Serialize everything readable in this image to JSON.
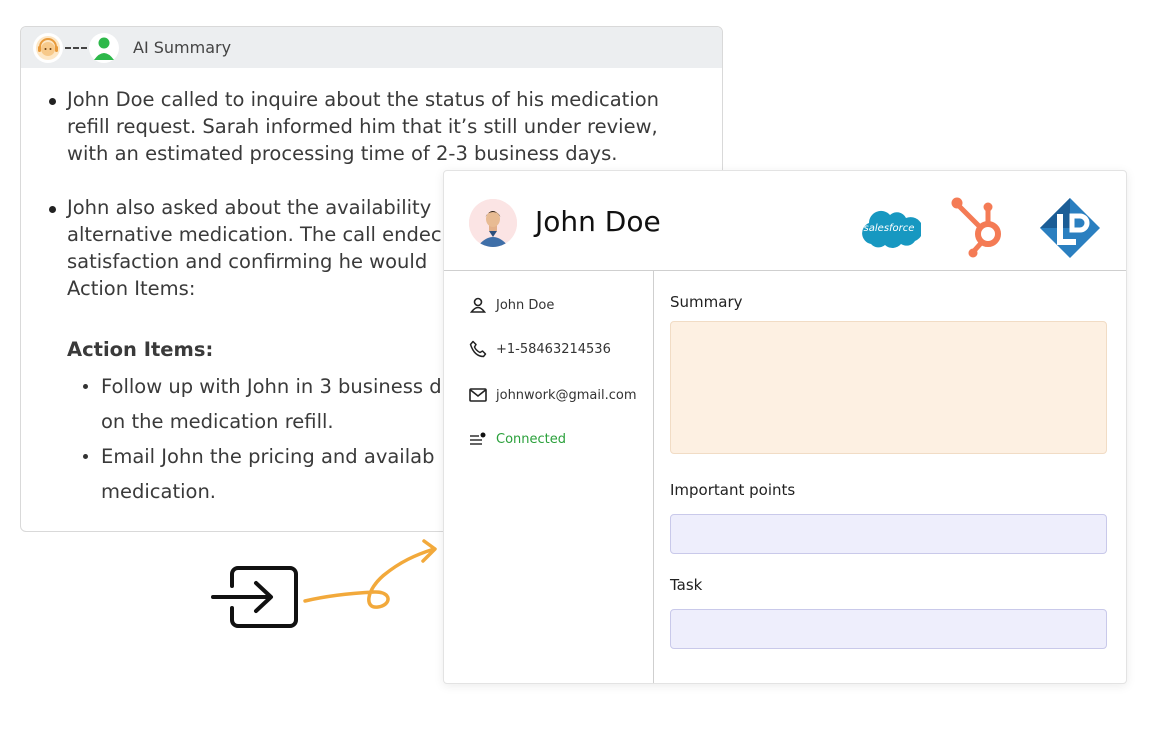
{
  "summary_card": {
    "title": "AI Summary",
    "bullets": [
      "John Doe called to inquire about the status of his medication refill request. Sarah informed him that it’s still under review, with an estimated processing time of 2-3 business days.",
      "John also asked about the availability alternative medication. The call endec satisfaction and confirming he would Action Items:"
    ],
    "bullet_lines": [
      [
        "John Doe called to inquire about the status of his medication",
        "refill request. Sarah informed him that it’s still under review,",
        "with an estimated processing time of 2-3 business days."
      ],
      [
        "John also asked about the availability",
        "alternative medication. The call endec",
        "satisfaction and confirming he would",
        "Action Items:"
      ]
    ],
    "action_items_title": "Action Items:",
    "action_items_lines": [
      [
        "Follow up with John in 3 business d",
        "on the medication refill."
      ],
      [
        "Email John the pricing and availab",
        "medication."
      ]
    ]
  },
  "contact_card": {
    "name": "John Doe",
    "logos": [
      "salesforce",
      "hubspot",
      "lp"
    ],
    "salesforce_text": "salesforce",
    "sidebar": {
      "name": "John Doe",
      "phone": "+1-58463214536",
      "email": "johnwork@gmail.com",
      "status": "Connected"
    },
    "fields": {
      "summary_label": "Summary",
      "important_points_label": "Important points",
      "task_label": "Task"
    }
  },
  "colors": {
    "status_green": "#2aa03b",
    "summary_box": "#fdf0e2",
    "input_box": "#eeeefc",
    "salesforce_blue": "#1798c1",
    "hubspot_orange": "#f47b55",
    "arrow_orange": "#f2a93b"
  }
}
